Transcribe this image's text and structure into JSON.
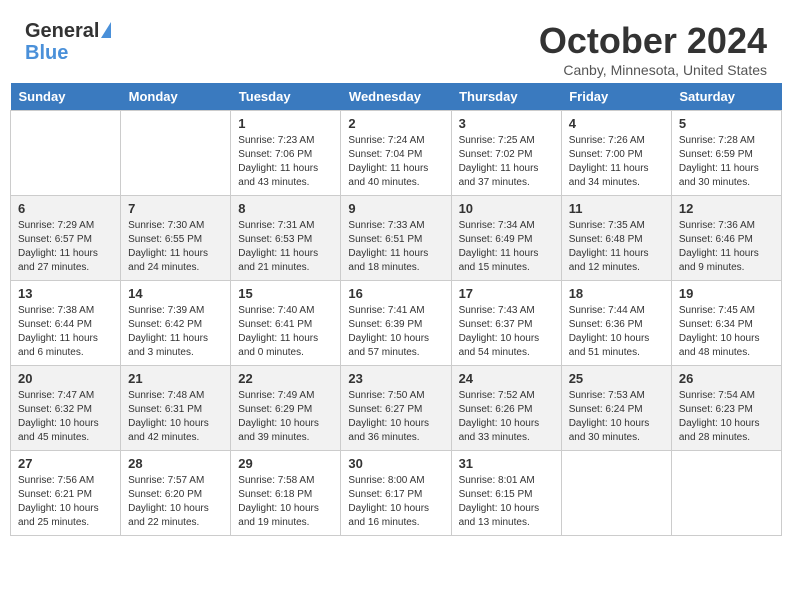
{
  "header": {
    "month_title": "October 2024",
    "location": "Canby, Minnesota, United States",
    "logo_line1": "General",
    "logo_line2": "Blue"
  },
  "days_of_week": [
    "Sunday",
    "Monday",
    "Tuesday",
    "Wednesday",
    "Thursday",
    "Friday",
    "Saturday"
  ],
  "weeks": [
    [
      {
        "day": "",
        "sunrise": "",
        "sunset": "",
        "daylight": ""
      },
      {
        "day": "",
        "sunrise": "",
        "sunset": "",
        "daylight": ""
      },
      {
        "day": "1",
        "sunrise": "Sunrise: 7:23 AM",
        "sunset": "Sunset: 7:06 PM",
        "daylight": "Daylight: 11 hours and 43 minutes."
      },
      {
        "day": "2",
        "sunrise": "Sunrise: 7:24 AM",
        "sunset": "Sunset: 7:04 PM",
        "daylight": "Daylight: 11 hours and 40 minutes."
      },
      {
        "day": "3",
        "sunrise": "Sunrise: 7:25 AM",
        "sunset": "Sunset: 7:02 PM",
        "daylight": "Daylight: 11 hours and 37 minutes."
      },
      {
        "day": "4",
        "sunrise": "Sunrise: 7:26 AM",
        "sunset": "Sunset: 7:00 PM",
        "daylight": "Daylight: 11 hours and 34 minutes."
      },
      {
        "day": "5",
        "sunrise": "Sunrise: 7:28 AM",
        "sunset": "Sunset: 6:59 PM",
        "daylight": "Daylight: 11 hours and 30 minutes."
      }
    ],
    [
      {
        "day": "6",
        "sunrise": "Sunrise: 7:29 AM",
        "sunset": "Sunset: 6:57 PM",
        "daylight": "Daylight: 11 hours and 27 minutes."
      },
      {
        "day": "7",
        "sunrise": "Sunrise: 7:30 AM",
        "sunset": "Sunset: 6:55 PM",
        "daylight": "Daylight: 11 hours and 24 minutes."
      },
      {
        "day": "8",
        "sunrise": "Sunrise: 7:31 AM",
        "sunset": "Sunset: 6:53 PM",
        "daylight": "Daylight: 11 hours and 21 minutes."
      },
      {
        "day": "9",
        "sunrise": "Sunrise: 7:33 AM",
        "sunset": "Sunset: 6:51 PM",
        "daylight": "Daylight: 11 hours and 18 minutes."
      },
      {
        "day": "10",
        "sunrise": "Sunrise: 7:34 AM",
        "sunset": "Sunset: 6:49 PM",
        "daylight": "Daylight: 11 hours and 15 minutes."
      },
      {
        "day": "11",
        "sunrise": "Sunrise: 7:35 AM",
        "sunset": "Sunset: 6:48 PM",
        "daylight": "Daylight: 11 hours and 12 minutes."
      },
      {
        "day": "12",
        "sunrise": "Sunrise: 7:36 AM",
        "sunset": "Sunset: 6:46 PM",
        "daylight": "Daylight: 11 hours and 9 minutes."
      }
    ],
    [
      {
        "day": "13",
        "sunrise": "Sunrise: 7:38 AM",
        "sunset": "Sunset: 6:44 PM",
        "daylight": "Daylight: 11 hours and 6 minutes."
      },
      {
        "day": "14",
        "sunrise": "Sunrise: 7:39 AM",
        "sunset": "Sunset: 6:42 PM",
        "daylight": "Daylight: 11 hours and 3 minutes."
      },
      {
        "day": "15",
        "sunrise": "Sunrise: 7:40 AM",
        "sunset": "Sunset: 6:41 PM",
        "daylight": "Daylight: 11 hours and 0 minutes."
      },
      {
        "day": "16",
        "sunrise": "Sunrise: 7:41 AM",
        "sunset": "Sunset: 6:39 PM",
        "daylight": "Daylight: 10 hours and 57 minutes."
      },
      {
        "day": "17",
        "sunrise": "Sunrise: 7:43 AM",
        "sunset": "Sunset: 6:37 PM",
        "daylight": "Daylight: 10 hours and 54 minutes."
      },
      {
        "day": "18",
        "sunrise": "Sunrise: 7:44 AM",
        "sunset": "Sunset: 6:36 PM",
        "daylight": "Daylight: 10 hours and 51 minutes."
      },
      {
        "day": "19",
        "sunrise": "Sunrise: 7:45 AM",
        "sunset": "Sunset: 6:34 PM",
        "daylight": "Daylight: 10 hours and 48 minutes."
      }
    ],
    [
      {
        "day": "20",
        "sunrise": "Sunrise: 7:47 AM",
        "sunset": "Sunset: 6:32 PM",
        "daylight": "Daylight: 10 hours and 45 minutes."
      },
      {
        "day": "21",
        "sunrise": "Sunrise: 7:48 AM",
        "sunset": "Sunset: 6:31 PM",
        "daylight": "Daylight: 10 hours and 42 minutes."
      },
      {
        "day": "22",
        "sunrise": "Sunrise: 7:49 AM",
        "sunset": "Sunset: 6:29 PM",
        "daylight": "Daylight: 10 hours and 39 minutes."
      },
      {
        "day": "23",
        "sunrise": "Sunrise: 7:50 AM",
        "sunset": "Sunset: 6:27 PM",
        "daylight": "Daylight: 10 hours and 36 minutes."
      },
      {
        "day": "24",
        "sunrise": "Sunrise: 7:52 AM",
        "sunset": "Sunset: 6:26 PM",
        "daylight": "Daylight: 10 hours and 33 minutes."
      },
      {
        "day": "25",
        "sunrise": "Sunrise: 7:53 AM",
        "sunset": "Sunset: 6:24 PM",
        "daylight": "Daylight: 10 hours and 30 minutes."
      },
      {
        "day": "26",
        "sunrise": "Sunrise: 7:54 AM",
        "sunset": "Sunset: 6:23 PM",
        "daylight": "Daylight: 10 hours and 28 minutes."
      }
    ],
    [
      {
        "day": "27",
        "sunrise": "Sunrise: 7:56 AM",
        "sunset": "Sunset: 6:21 PM",
        "daylight": "Daylight: 10 hours and 25 minutes."
      },
      {
        "day": "28",
        "sunrise": "Sunrise: 7:57 AM",
        "sunset": "Sunset: 6:20 PM",
        "daylight": "Daylight: 10 hours and 22 minutes."
      },
      {
        "day": "29",
        "sunrise": "Sunrise: 7:58 AM",
        "sunset": "Sunset: 6:18 PM",
        "daylight": "Daylight: 10 hours and 19 minutes."
      },
      {
        "day": "30",
        "sunrise": "Sunrise: 8:00 AM",
        "sunset": "Sunset: 6:17 PM",
        "daylight": "Daylight: 10 hours and 16 minutes."
      },
      {
        "day": "31",
        "sunrise": "Sunrise: 8:01 AM",
        "sunset": "Sunset: 6:15 PM",
        "daylight": "Daylight: 10 hours and 13 minutes."
      },
      {
        "day": "",
        "sunrise": "",
        "sunset": "",
        "daylight": ""
      },
      {
        "day": "",
        "sunrise": "",
        "sunset": "",
        "daylight": ""
      }
    ]
  ]
}
